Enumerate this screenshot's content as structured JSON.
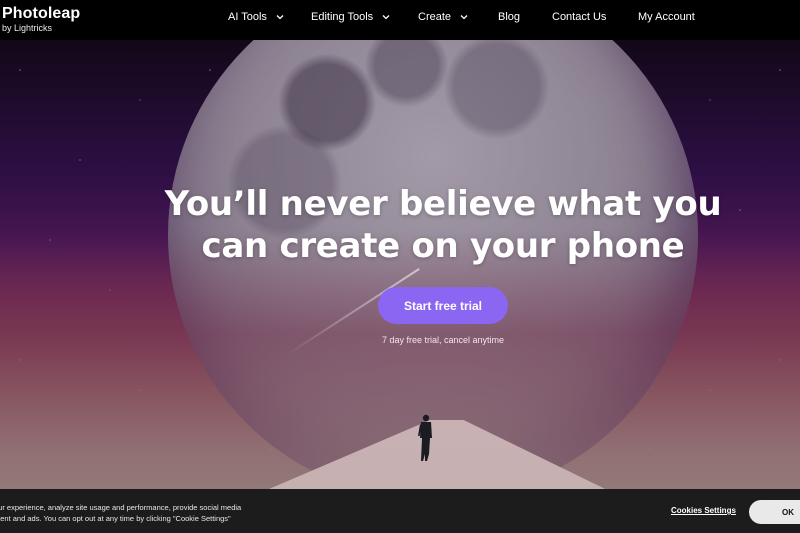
{
  "brand": {
    "name": "Photoleap",
    "subtitle": "by Lightricks"
  },
  "nav": {
    "items": [
      {
        "label": "AI Tools",
        "has_dropdown": true,
        "icon": "chevron-down-icon"
      },
      {
        "label": "Editing Tools",
        "has_dropdown": true,
        "icon": "chevron-down-icon"
      },
      {
        "label": "Create",
        "has_dropdown": true,
        "icon": "chevron-down-icon"
      },
      {
        "label": "Blog",
        "has_dropdown": false
      },
      {
        "label": "Contact Us",
        "has_dropdown": false
      },
      {
        "label": "My Account",
        "has_dropdown": false
      }
    ]
  },
  "hero": {
    "headline_line1": "You’ll never believe what you",
    "headline_line2": "can create on your phone",
    "cta_label": "Start free trial",
    "cta_subtext": "7 day free trial, cancel anytime",
    "accent_color": "#8a66f2"
  },
  "cookie_banner": {
    "text_line1": "our experience, analyze site usage and performance, provide social media",
    "text_line2": "ntent and ads. You can opt out at any time by clicking \"Cookie Settings\"",
    "settings_label": "Cookies Settings",
    "ok_label": "OK"
  }
}
